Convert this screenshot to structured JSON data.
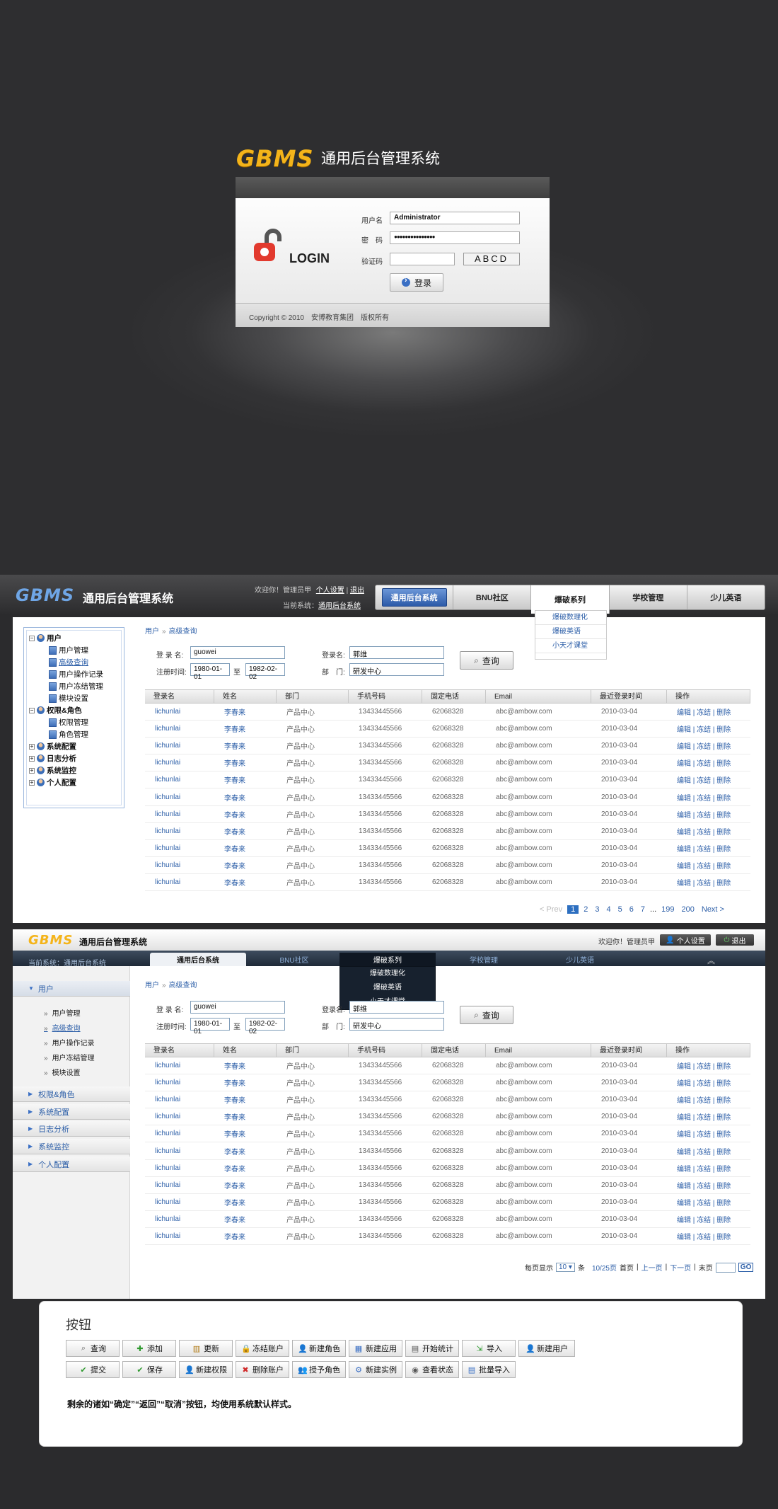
{
  "login": {
    "logo": "GBMS",
    "title": "通用后台管理系统",
    "login_word": "LOGIN",
    "username_label": "用户名",
    "username_value": "Administrator",
    "password_label": "密　码",
    "password_value": "●●●●●●●●●●●●●●●",
    "captcha_label": "验证码",
    "captcha_value": "",
    "captcha_text": "ABCD",
    "login_button": "登录",
    "copyright": "Copyright © 2010　安博教育集团　版权所有"
  },
  "screenA": {
    "logo": "GBMS",
    "title": "通用后台管理系统",
    "welcome": "欢迎你！管理员甲",
    "personal_settings": "个人设置",
    "logout": "退出",
    "current_system_label": "当前系统：",
    "current_system": "通用后台系统",
    "nav": [
      "通用后台系统",
      "BNU社区",
      "爆破系列",
      "学校管理",
      "少儿英语"
    ],
    "dropdown": [
      "爆破数理化",
      "爆破英语",
      "小天才课堂"
    ],
    "tree": {
      "user": "用户",
      "user_children": [
        "用户管理",
        "高级查询",
        "用户操作记录",
        "用户冻结管理",
        "模块设置"
      ],
      "perm": "权限&角色",
      "perm_children": [
        "权限管理",
        "角色管理"
      ],
      "others": [
        "系统配置",
        "日志分析",
        "系统监控",
        "个人配置"
      ]
    },
    "pager": [
      "< Prev",
      "1",
      "2",
      "3",
      "4",
      "5",
      "6",
      "7",
      "...",
      "199",
      "200",
      "Next >"
    ]
  },
  "breadcrumb": {
    "root": "用户",
    "sep": "»",
    "current": "高级查询"
  },
  "search": {
    "login_label": "登 录 名:",
    "login_value": "guowei",
    "name_label": "登录名:",
    "name_value": "郭维",
    "date_label": "注册时间:",
    "date_from": "1980-01-01",
    "date_to_label": "至",
    "date_to": "1982-02-02",
    "dept_label": "部　门:",
    "dept_value": "研发中心",
    "query_button": "查询"
  },
  "table": {
    "headers": [
      "登录名",
      "姓名",
      "部门",
      "手机号码",
      "固定电话",
      "Email",
      "最近登录时间",
      "操作"
    ],
    "row": {
      "login": "lichunlai",
      "name": "李春来",
      "dept": "产品中心",
      "mobile": "13433445566",
      "phone": "62068328",
      "email": "abc@ambow.com",
      "last_login": "2010-03-04",
      "actions": "编辑 | 冻结 | 删除"
    },
    "row_count": 11
  },
  "screenB": {
    "logo": "GBMS",
    "title": "通用后台管理系统",
    "welcome": "欢迎你！管理员甲",
    "personal_settings": "个人设置",
    "logout": "退出",
    "current_system": "当前系统：通用后台系统",
    "nav": [
      "通用后台系统",
      "BNU社区",
      "爆破系列",
      "学校管理",
      "少儿英语"
    ],
    "dropdown": [
      "爆破数理化",
      "爆破英语",
      "小天才课堂"
    ],
    "side": {
      "user": "用户",
      "user_children": [
        "用户管理",
        "高级查询",
        "用户操作记录",
        "用户冻结管理",
        "模块设置"
      ],
      "others": [
        "权限&角色",
        "系统配置",
        "日志分析",
        "系统监控",
        "个人配置"
      ]
    },
    "pager": {
      "per_page_label": "每页显示",
      "per_page": "10",
      "unit": "条",
      "pages": "10/25页",
      "first": "首页",
      "prev": "上一页",
      "next": "下一页",
      "last": "末页",
      "go": "GO"
    }
  },
  "buttons_panel": {
    "title": "按钮",
    "row1": [
      {
        "label": "查询",
        "icon": "search-icon",
        "glyph": "⌕",
        "color": "#666"
      },
      {
        "label": "添加",
        "icon": "plus-icon",
        "glyph": "✚",
        "color": "#2e9a2e"
      },
      {
        "label": "更新",
        "icon": "update-icon",
        "glyph": "▥",
        "color": "#b07a16"
      },
      {
        "label": "冻结账户",
        "icon": "lock-icon",
        "glyph": "🔒",
        "color": "#c89a2a"
      },
      {
        "label": "新建角色",
        "icon": "user-icon",
        "glyph": "👤",
        "color": "#3a6fc4"
      },
      {
        "label": "新建应用",
        "icon": "app-icon",
        "glyph": "▦",
        "color": "#3a6fc4"
      },
      {
        "label": "开始统计",
        "icon": "stats-icon",
        "glyph": "▤",
        "color": "#555"
      },
      {
        "label": "导入",
        "icon": "import-icon",
        "glyph": "⇲",
        "color": "#2e9a2e"
      },
      {
        "label": "新建用户",
        "icon": "add-user-icon",
        "glyph": "👤",
        "color": "#2e9a2e"
      }
    ],
    "row2": [
      {
        "label": "提交",
        "icon": "check-icon",
        "glyph": "✔",
        "color": "#2e9a2e"
      },
      {
        "label": "保存",
        "icon": "save-icon",
        "glyph": "✔",
        "color": "#2e9a2e"
      },
      {
        "label": "新建权限",
        "icon": "permission-icon",
        "glyph": "👤",
        "color": "#333"
      },
      {
        "label": "删除账户",
        "icon": "delete-icon",
        "glyph": "✖",
        "color": "#d12b2b"
      },
      {
        "label": "授予角色",
        "icon": "grant-role-icon",
        "glyph": "👥",
        "color": "#3a6fc4"
      },
      {
        "label": "新建实例",
        "icon": "instance-icon",
        "glyph": "⚙",
        "color": "#3a6fc4"
      },
      {
        "label": "查看状态",
        "icon": "eye-icon",
        "glyph": "◉",
        "color": "#555"
      },
      {
        "label": "批量导入",
        "icon": "batch-import-icon",
        "glyph": "▤",
        "color": "#3a6fc4"
      }
    ],
    "note": "剩余的诸如“确定”“返回”“取消”按钮，均使用系统默认样式。"
  }
}
